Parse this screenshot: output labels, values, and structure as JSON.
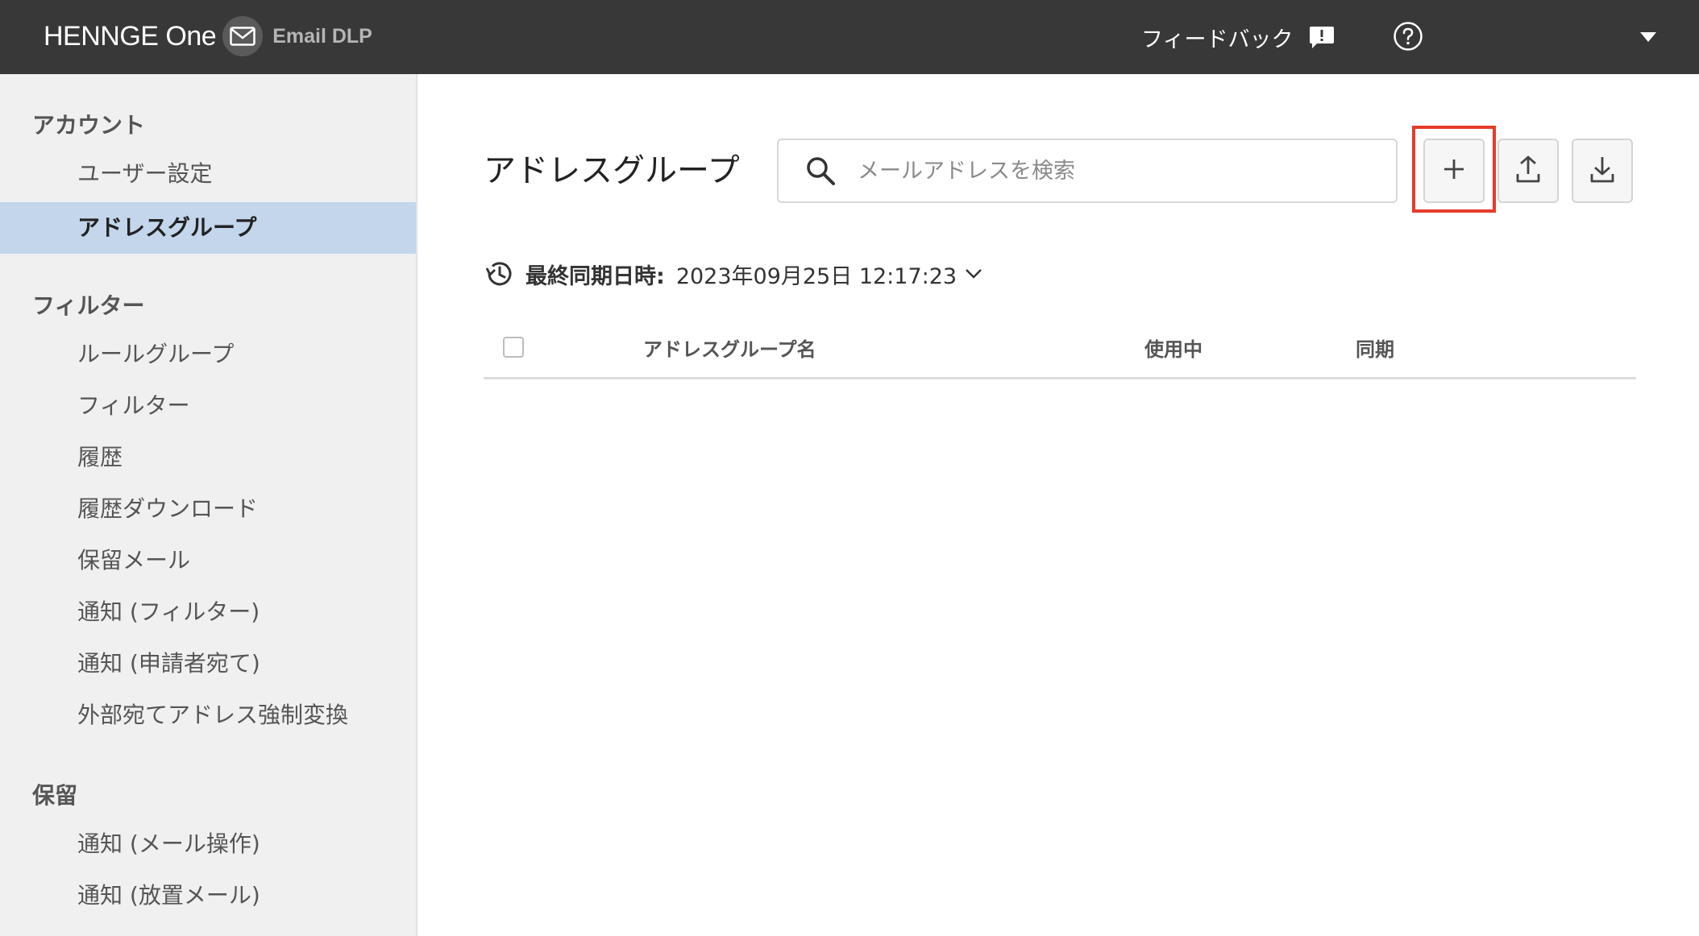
{
  "header": {
    "brand_name": "HENNGE One",
    "product_name": "Email DLP",
    "feedback_label": "フィードバック",
    "icons": [
      "mail-icon",
      "feedback-icon",
      "help-icon",
      "chevron-down-icon"
    ]
  },
  "sidebar": {
    "sections": [
      {
        "title": "アカウント",
        "items": [
          {
            "label": "ユーザー設定"
          },
          {
            "label": "アドレスグループ",
            "active": true
          }
        ]
      },
      {
        "title": "フィルター",
        "items": [
          {
            "label": "ルールグループ"
          },
          {
            "label": "フィルター"
          },
          {
            "label": "履歴"
          },
          {
            "label": "履歴ダウンロード"
          },
          {
            "label": "保留メール"
          },
          {
            "label": "通知 (フィルター)"
          },
          {
            "label": "通知 (申請者宛て)"
          },
          {
            "label": "外部宛てアドレス強制変換"
          }
        ]
      },
      {
        "title": "保留",
        "items": [
          {
            "label": "通知 (メール操作)"
          },
          {
            "label": "通知 (放置メール)"
          }
        ]
      }
    ]
  },
  "main": {
    "title": "アドレスグループ",
    "search": {
      "placeholder": "メールアドレスを検索",
      "value": ""
    },
    "toolbar": {
      "buttons": [
        "add-icon",
        "upload-icon",
        "download-icon"
      ],
      "highlighted": "add-icon",
      "highlight_color": "#e53b2c"
    },
    "sync": {
      "label": "最終同期日時:",
      "value": "2023年09月25日 12:17:23"
    },
    "table": {
      "columns": [
        "アドレスグループ名",
        "使用中",
        "同期"
      ],
      "rows": []
    }
  },
  "colors": {
    "header_bg": "#383838",
    "sidebar_bg": "#f0f0f0",
    "active_item_bg": "#c4d6ec"
  }
}
